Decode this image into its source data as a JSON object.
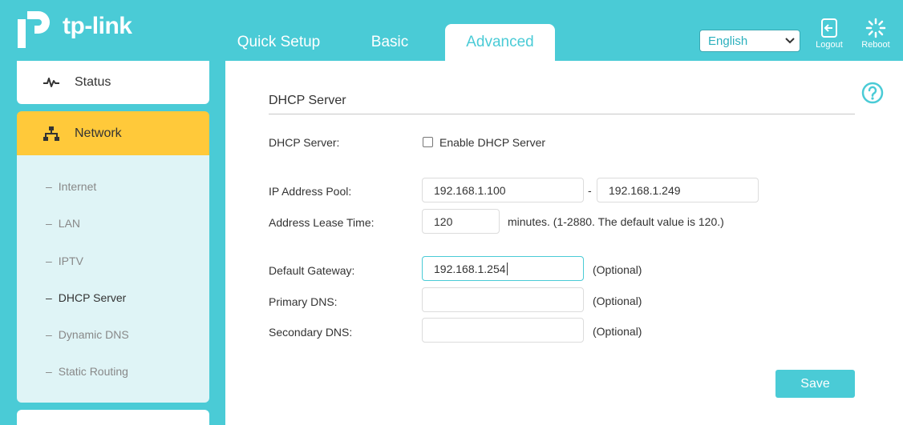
{
  "header": {
    "logo_text": "tp-link",
    "tabs": [
      {
        "label": "Quick Setup"
      },
      {
        "label": "Basic"
      },
      {
        "label": "Advanced"
      }
    ],
    "language": "English",
    "logout_label": "Logout",
    "reboot_label": "Reboot"
  },
  "sidebar": {
    "status_label": "Status",
    "network_label": "Network",
    "submenu": [
      {
        "label": "Internet"
      },
      {
        "label": "LAN"
      },
      {
        "label": "IPTV"
      },
      {
        "label": "DHCP Server"
      },
      {
        "label": "Dynamic DNS"
      },
      {
        "label": "Static Routing"
      }
    ],
    "submenu_dash": "–"
  },
  "main": {
    "section_title": "DHCP Server",
    "dhcp_server_label": "DHCP Server:",
    "enable_label": "Enable DHCP Server",
    "enable_checked": false,
    "ip_pool_label": "IP Address Pool:",
    "ip_pool_start": "192.168.1.100",
    "ip_pool_sep": "-",
    "ip_pool_end": "192.168.1.249",
    "lease_label": "Address Lease Time:",
    "lease_value": "120",
    "lease_hint": "minutes. (1-2880. The default value is 120.)",
    "gateway_label": "Default Gateway:",
    "gateway_value": "192.168.1.254",
    "primary_dns_label": "Primary DNS:",
    "primary_dns_value": "",
    "secondary_dns_label": "Secondary DNS:",
    "secondary_dns_value": "",
    "optional_text": "(Optional)",
    "save_label": "Save"
  },
  "colors": {
    "brand": "#4acbd6",
    "active_menu": "#ffc93a",
    "submenu_bg": "#dff4f6"
  }
}
